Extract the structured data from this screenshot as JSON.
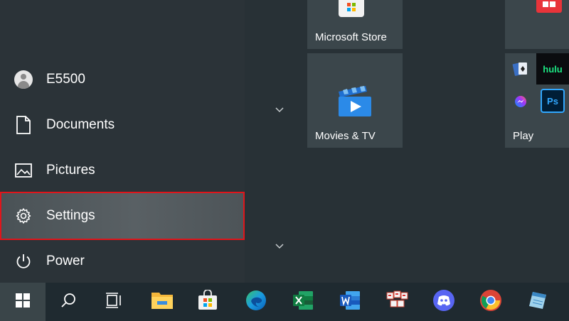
{
  "start_menu": {
    "user": {
      "label": "E5500"
    },
    "items": [
      {
        "label": "Documents"
      },
      {
        "label": "Pictures"
      },
      {
        "label": "Settings"
      },
      {
        "label": "Power"
      }
    ],
    "highlight_color": "#e0151b"
  },
  "tiles": {
    "microsoft_store": {
      "label": "Microsoft Store"
    },
    "movies_tv": {
      "label": "Movies & TV"
    },
    "play": {
      "label": "Play"
    },
    "hulu": {
      "text": "hulu"
    },
    "photoshop": {
      "text": "Ps"
    }
  },
  "taskbar": {
    "apps": [
      "windows-start-icon",
      "search-icon",
      "task-view-icon",
      "file-explorer-icon",
      "microsoft-store-icon",
      "edge-icon",
      "excel-icon",
      "word-icon",
      "typing-app-icon",
      "discord-icon",
      "chrome-icon",
      "notepad-icon"
    ]
  },
  "colors": {
    "rail_bg": "#2b3338",
    "tile_bg": "#3b464b",
    "taskbar_bg": "#1f2a30"
  }
}
